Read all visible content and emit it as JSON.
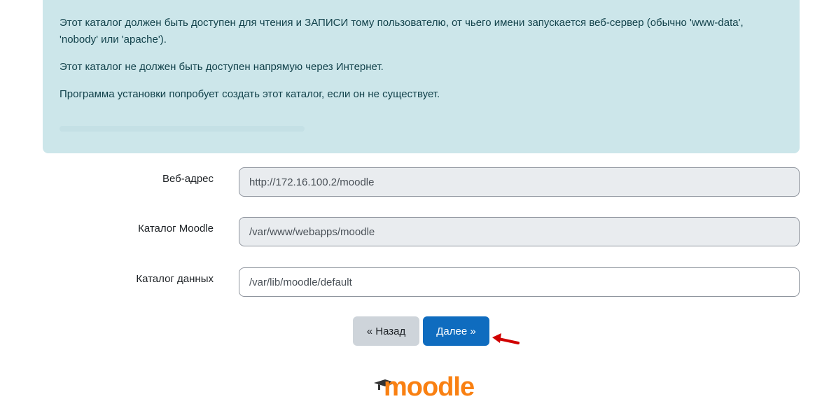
{
  "notice": {
    "paragraph_1": "Этот каталог должен быть доступен для чтения и ЗАПИСИ тому пользователю, от чьего имени запускается веб-сервер (обычно 'www-data', 'nobody' или 'apache').",
    "paragraph_2": "Этот каталог не должен быть доступен напрямую через Интернет.",
    "paragraph_3": "Программа установки попробует создать этот каталог, если он не существует."
  },
  "form": {
    "web_address": {
      "label": "Веб-адрес",
      "value": "http://172.16.100.2/moodle"
    },
    "moodle_dir": {
      "label": "Каталог Moodle",
      "value": "/var/www/webapps/moodle"
    },
    "data_dir": {
      "label": "Каталог данных",
      "value": "/var/lib/moodle/default"
    }
  },
  "buttons": {
    "back_label": "« Назад",
    "next_label": "Далее »"
  },
  "logo": {
    "text": "moodle"
  },
  "colors": {
    "notice_bg": "#cce6ea",
    "primary": "#0f6cbf",
    "arrow": "#d00000",
    "logo_orange": "#f98012"
  }
}
